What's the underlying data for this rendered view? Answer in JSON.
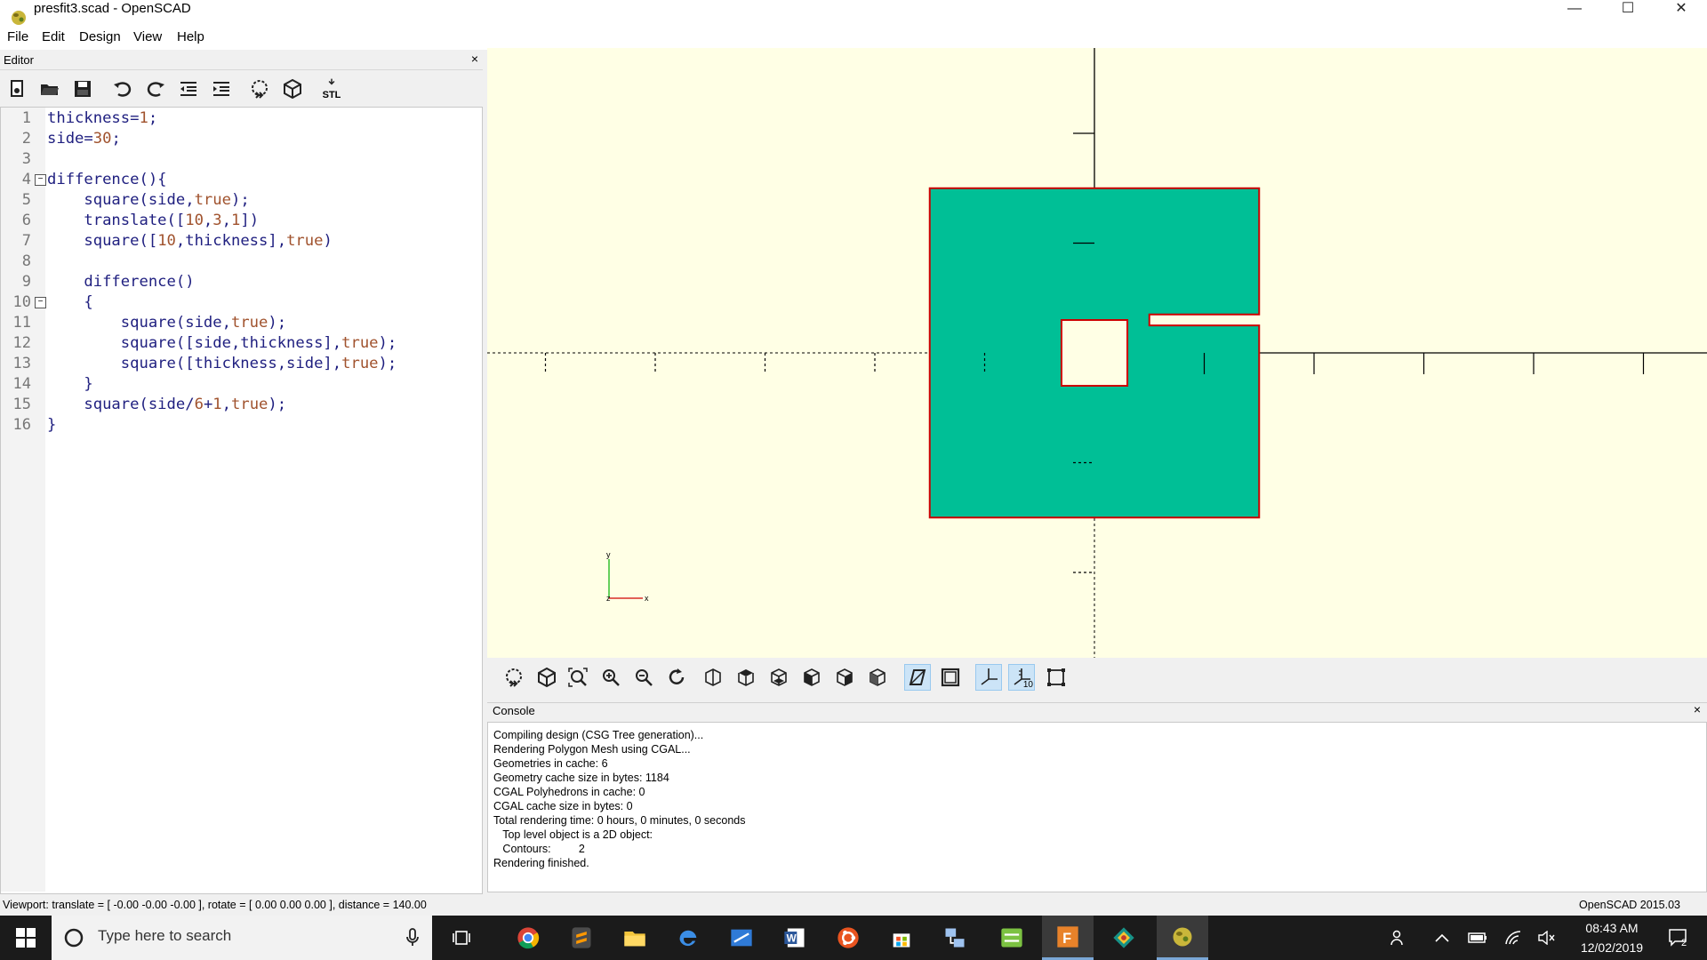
{
  "window": {
    "title": "presfit3.scad - OpenSCAD",
    "minimize_glyph": "—",
    "maximize_glyph": "☐",
    "close_glyph": "✕"
  },
  "menu": [
    "File",
    "Edit",
    "Design",
    "View",
    "Help"
  ],
  "editor": {
    "title": "Editor",
    "close_glyph": "×",
    "toolbar_icons": [
      "new-file-icon",
      "open-file-icon",
      "save-icon",
      "undo-icon",
      "redo-icon",
      "unindent-icon",
      "indent-icon",
      "preview-icon",
      "render-icon",
      "export-stl-icon"
    ],
    "stl_label": "STL",
    "lines": [
      {
        "n": "1",
        "text": "thickness=1;"
      },
      {
        "n": "2",
        "text": "side=30;"
      },
      {
        "n": "3",
        "text": ""
      },
      {
        "n": "4",
        "text": "difference(){"
      },
      {
        "n": "5",
        "text": "    square(side,true);"
      },
      {
        "n": "6",
        "text": "    translate([10,3,1])"
      },
      {
        "n": "7",
        "text": "    square([10,thickness],true)"
      },
      {
        "n": "8",
        "text": ""
      },
      {
        "n": "9",
        "text": "    difference()"
      },
      {
        "n": "10",
        "text": "    {"
      },
      {
        "n": "11",
        "text": "        square(side,true);"
      },
      {
        "n": "12",
        "text": "        square([side,thickness],true);"
      },
      {
        "n": "13",
        "text": "        square([thickness,side],true);"
      },
      {
        "n": "14",
        "text": "    }"
      },
      {
        "n": "15",
        "text": "    square(side/6+1,true);"
      },
      {
        "n": "16",
        "text": "}"
      }
    ],
    "fold_lines": [
      "4",
      "10"
    ]
  },
  "viewport": {
    "background": "#ffffe5",
    "shape_fill": "#00bf96",
    "shape_outline": "#cc0000",
    "axis_labels": {
      "x": "x",
      "y": "y",
      "z": "z"
    }
  },
  "view_toolbar": {
    "icons": [
      "preview-icon",
      "render-icon",
      "view-all-icon",
      "zoom-in-icon",
      "zoom-out-icon",
      "reset-view-icon",
      "view-right-icon",
      "view-top-icon",
      "view-bottom-icon",
      "view-left-icon",
      "view-front-icon",
      "view-back-icon",
      "perspective-icon",
      "orthogonal-icon",
      "show-axes-icon",
      "show-scale-markers-icon",
      "show-edges-icon"
    ],
    "active": [
      "perspective-icon",
      "show-axes-icon",
      "show-scale-markers-icon"
    ],
    "scale_label": "10"
  },
  "console": {
    "title": "Console",
    "close_glyph": "×",
    "lines": [
      "Compiling design (CSG Tree generation)...",
      "Rendering Polygon Mesh using CGAL...",
      "Geometries in cache: 6",
      "Geometry cache size in bytes: 1184",
      "CGAL Polyhedrons in cache: 0",
      "CGAL cache size in bytes: 0",
      "Total rendering time: 0 hours, 0 minutes, 0 seconds",
      "   Top level object is a 2D object:",
      "   Contours:         2",
      "Rendering finished."
    ]
  },
  "status": {
    "viewport": "Viewport: translate = [ -0.00 -0.00 -0.00 ], rotate = [ 0.00 0.00 0.00 ], distance = 140.00",
    "version": "OpenSCAD 2015.03"
  },
  "taskbar": {
    "search_placeholder": "Type here to search",
    "apps": [
      "chrome-icon",
      "sublime-text-icon",
      "file-explorer-icon",
      "edge-icon",
      "scanner-icon",
      "word-icon",
      "ubuntu-icon",
      "store-icon",
      "network-app-icon",
      "green-app-icon",
      "foxit-icon",
      "gitkraken-icon",
      "openscad-icon"
    ],
    "time": "08:43 AM",
    "date": "12/02/2019",
    "notification_count": "2"
  }
}
